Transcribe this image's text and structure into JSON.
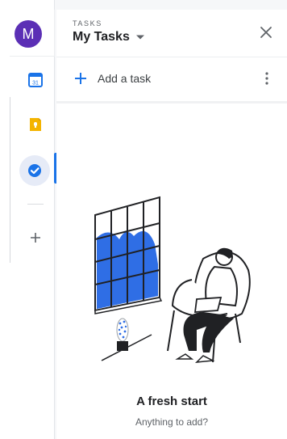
{
  "rail": {
    "avatar_initial": "M",
    "items": [
      {
        "name": "calendar-icon",
        "label": "31"
      },
      {
        "name": "keep-icon"
      },
      {
        "name": "tasks-icon",
        "active": true
      },
      {
        "name": "add-icon"
      }
    ]
  },
  "header": {
    "kicker": "TASKS",
    "title": "My Tasks"
  },
  "add_task": {
    "label": "Add a task"
  },
  "empty_state": {
    "title": "A fresh start",
    "subtitle": "Anything to add?"
  },
  "colors": {
    "avatar": "#5b2fb5",
    "accent": "#1a73e8",
    "keep": "#f4b400",
    "illustration_blue": "#2f6ee5"
  }
}
